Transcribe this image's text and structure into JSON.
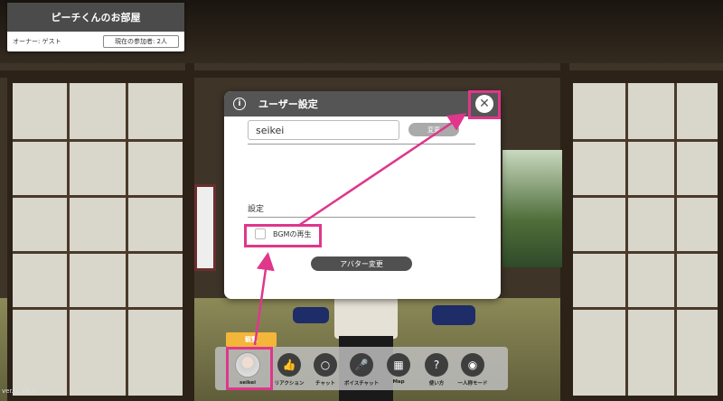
{
  "room": {
    "title": "ピーチくんのお部屋",
    "owner": "オーナー: ゲスト",
    "participants": "現在の参加者: 2人"
  },
  "dialog": {
    "title": "ユーザー設定",
    "info_icon": "info-icon",
    "close_icon": "close-icon",
    "name_value": "seikei",
    "change_label": "変更",
    "settings_heading": "設定",
    "bgm_label": "BGMの再生",
    "bgm_checked": false,
    "avatar_change_label": "アバター変更"
  },
  "toolbar": {
    "viewer_badge": "観覧",
    "user_label": "seikei",
    "items": [
      {
        "label": "リアクション",
        "icon": "thumbs-up-icon"
      },
      {
        "label": "チャット",
        "icon": "chat-bubble-icon"
      },
      {
        "label": "ボイスチャット",
        "icon": "microphone-icon"
      },
      {
        "label": "Map",
        "icon": "map-icon"
      },
      {
        "label": "使い方",
        "icon": "question-icon"
      },
      {
        "label": "一人称モード",
        "icon": "eye-icon"
      }
    ]
  },
  "version": "ver. 1.10.5",
  "colors": {
    "highlight": "#e0368c",
    "badge": "#f3b53a",
    "header": "#555555"
  }
}
